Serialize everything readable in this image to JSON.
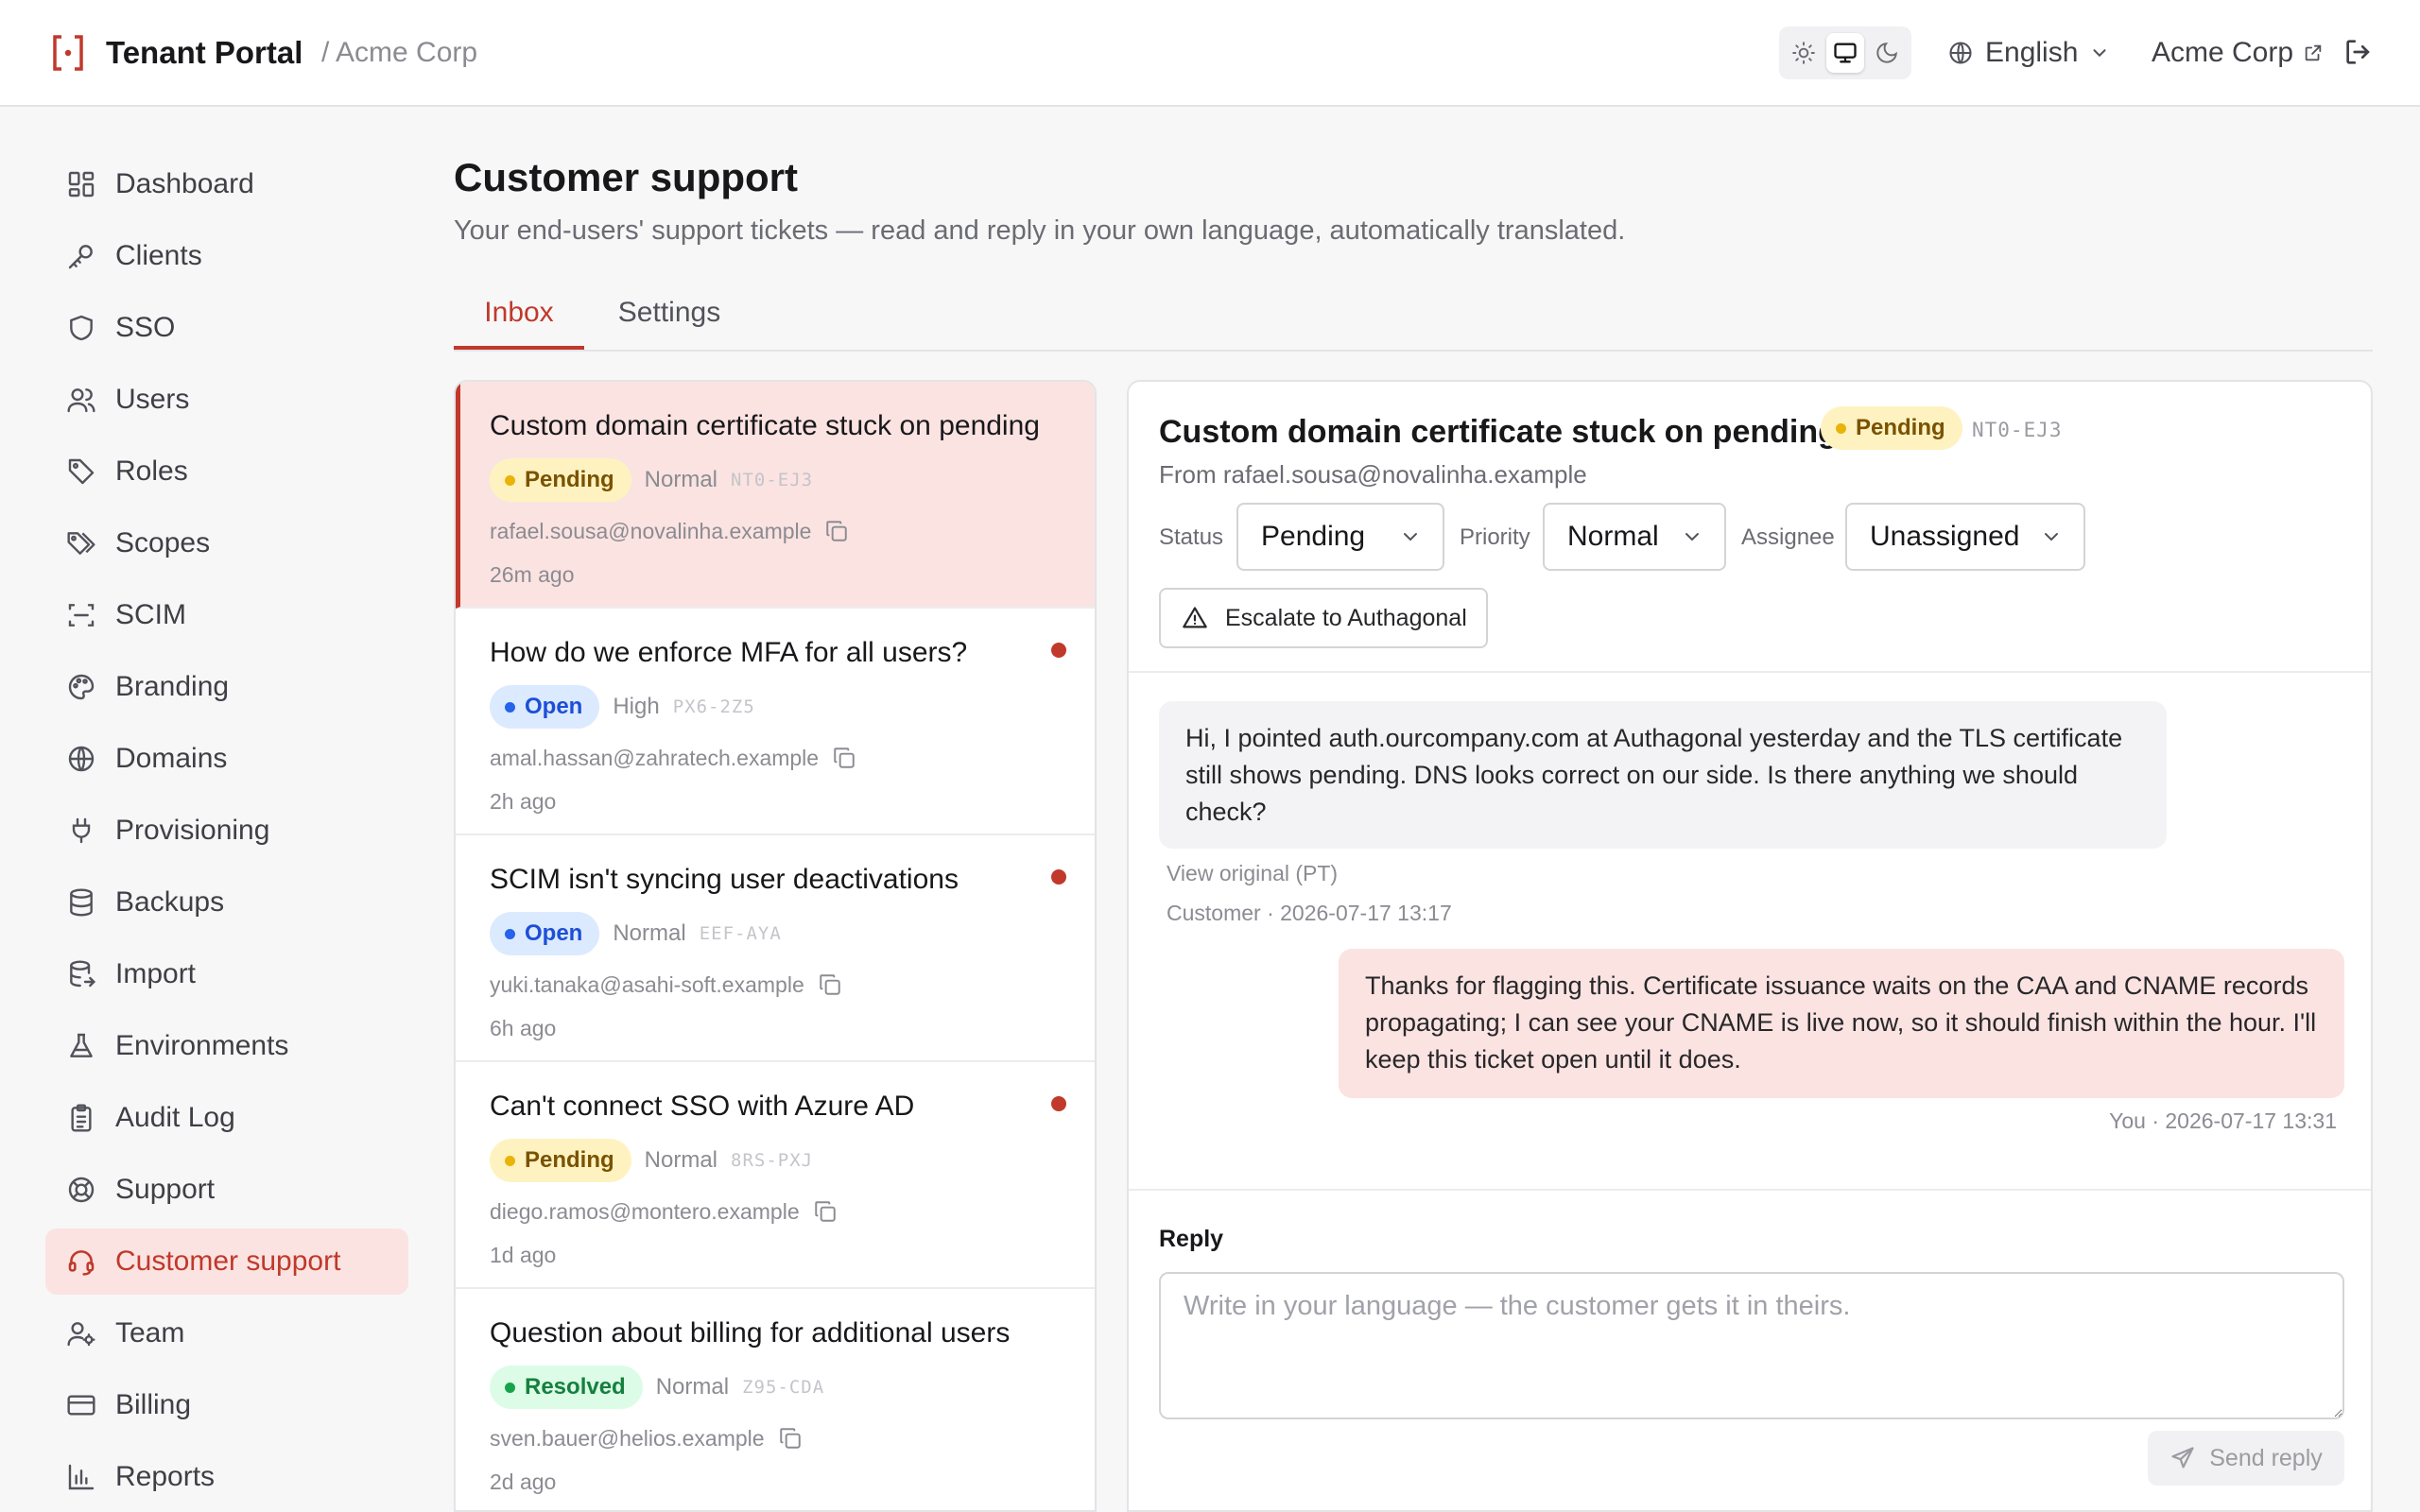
{
  "header": {
    "app_title": "Tenant Portal",
    "org_crumb": "/ Acme Corp",
    "theme_options": [
      "light-icon",
      "system-icon",
      "dark-icon"
    ],
    "theme_selected": "system",
    "language": "English",
    "org_link": "Acme Corp"
  },
  "sidebar": {
    "items": [
      {
        "label": "Dashboard",
        "icon": "dashboard-icon"
      },
      {
        "label": "Clients",
        "icon": "key-icon"
      },
      {
        "label": "SSO",
        "icon": "shield-icon"
      },
      {
        "label": "Users",
        "icon": "users-icon"
      },
      {
        "label": "Roles",
        "icon": "tag-icon"
      },
      {
        "label": "Scopes",
        "icon": "tags-icon"
      },
      {
        "label": "SCIM",
        "icon": "scan-icon"
      },
      {
        "label": "Branding",
        "icon": "palette-icon"
      },
      {
        "label": "Domains",
        "icon": "globe-icon"
      },
      {
        "label": "Provisioning",
        "icon": "plug-icon"
      },
      {
        "label": "Backups",
        "icon": "database-icon"
      },
      {
        "label": "Import",
        "icon": "database-import-icon"
      },
      {
        "label": "Environments",
        "icon": "flask-icon"
      },
      {
        "label": "Audit Log",
        "icon": "clipboard-icon"
      },
      {
        "label": "Support",
        "icon": "lifebuoy-icon"
      },
      {
        "label": "Customer support",
        "icon": "headset-icon"
      },
      {
        "label": "Team",
        "icon": "user-cog-icon"
      },
      {
        "label": "Billing",
        "icon": "credit-card-icon"
      },
      {
        "label": "Reports",
        "icon": "bar-chart-icon"
      }
    ],
    "active": "Customer support"
  },
  "page": {
    "title": "Customer support",
    "subtitle": "Your end-users' support tickets — read and reply in your own language, automatically translated.",
    "tabs": [
      "Inbox",
      "Settings"
    ],
    "active_tab": "Inbox"
  },
  "tickets": [
    {
      "title": "Custom domain certificate stuck on pending",
      "status": "Pending",
      "priority": "Normal",
      "code": "NT0-EJ3",
      "email": "rafael.sousa@novalinha.example",
      "time": "26m ago",
      "unread": false,
      "selected": true
    },
    {
      "title": "How do we enforce MFA for all users?",
      "status": "Open",
      "priority": "High",
      "code": "PX6-2Z5",
      "email": "amal.hassan@zahratech.example",
      "time": "2h ago",
      "unread": true,
      "selected": false
    },
    {
      "title": "SCIM isn't syncing user deactivations",
      "status": "Open",
      "priority": "Normal",
      "code": "EEF-AYA",
      "email": "yuki.tanaka@asahi-soft.example",
      "time": "6h ago",
      "unread": true,
      "selected": false
    },
    {
      "title": "Can't connect SSO with Azure AD",
      "status": "Pending",
      "priority": "Normal",
      "code": "8RS-PXJ",
      "email": "diego.ramos@montero.example",
      "time": "1d ago",
      "unread": true,
      "selected": false
    },
    {
      "title": "Question about billing for additional users",
      "status": "Resolved",
      "priority": "Normal",
      "code": "Z95-CDA",
      "email": "sven.bauer@helios.example",
      "time": "2d ago",
      "unread": false,
      "selected": false
    }
  ],
  "detail": {
    "title": "Custom domain certificate stuck on pending",
    "status_badge": "Pending",
    "code": "NT0-EJ3",
    "from": "From rafael.sousa@novalinha.example",
    "status_label": "Status",
    "status_value": "Pending",
    "priority_label": "Priority",
    "priority_value": "Normal",
    "assignee_label": "Assignee",
    "assignee_value": "Unassigned",
    "escalate_label": "Escalate to Authagonal",
    "messages": {
      "incoming": {
        "text": "Hi, I pointed auth.ourcompany.com at Authagonal yesterday and the TLS certificate still shows pending. DNS looks correct on our side. Is there anything we should check?",
        "view_original": "View original (PT)",
        "meta": "Customer · 2026-07-17 13:17"
      },
      "outgoing": {
        "text": "Thanks for flagging this. Certificate issuance waits on the CAA and CNAME records propagating; I can see your CNAME is live now, so it should finish within the hour. I'll keep this ticket open until it does.",
        "meta": "You · 2026-07-17 13:31"
      }
    },
    "reply_label": "Reply",
    "reply_placeholder": "Write in your language — the customer gets it in theirs.",
    "send_label": "Send reply"
  },
  "colors": {
    "accent": "#c0392b",
    "accent_soft": "#fbe3e1",
    "pending": "#eab308",
    "open": "#2563eb",
    "resolved": "#16a34a"
  }
}
